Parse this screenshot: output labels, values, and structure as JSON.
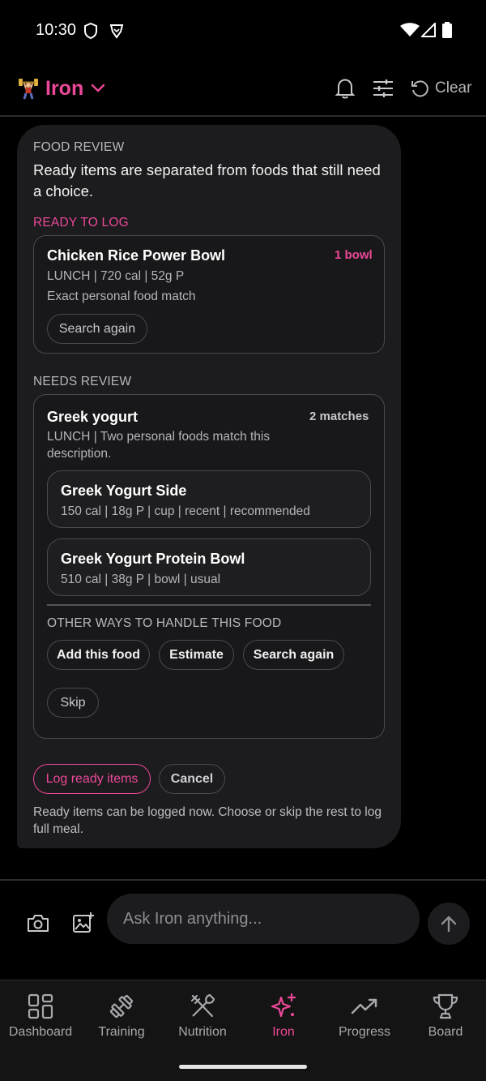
{
  "status": {
    "time": "10:30"
  },
  "header": {
    "app_name": "Iron",
    "clear_label": "Clear"
  },
  "card": {
    "section_label": "FOOD REVIEW",
    "lead": "Ready items are separated from foods that still need a choice.",
    "ready": {
      "label": "READY TO LOG",
      "item": {
        "title": "Chicken Rice Power Bowl",
        "badge": "1 bowl",
        "meta": "LUNCH | 720 cal | 52g P",
        "note": "Exact personal food match",
        "search_again": "Search again"
      }
    },
    "needs_review": {
      "label": "NEEDS REVIEW",
      "item": {
        "title": "Greek yogurt",
        "badge": "2 matches",
        "meta": "LUNCH | Two personal foods match this description.",
        "options": [
          {
            "title": "Greek Yogurt Side",
            "meta": "150 cal | 18g P | cup | recent | recommended"
          },
          {
            "title": "Greek Yogurt Protein Bowl",
            "meta": "510 cal | 38g P | bowl | usual"
          }
        ],
        "other_label": "OTHER WAYS TO HANDLE THIS FOOD",
        "actions": {
          "add": "Add this food",
          "estimate": "Estimate",
          "search": "Search again",
          "skip": "Skip"
        }
      }
    },
    "footer": {
      "log_ready": "Log ready items",
      "cancel": "Cancel",
      "hint": "Ready items can be logged now. Choose or skip the rest to log full meal."
    }
  },
  "composer": {
    "placeholder": "Ask Iron anything..."
  },
  "nav": {
    "items": [
      {
        "label": "Dashboard",
        "icon": "dashboard-icon"
      },
      {
        "label": "Training",
        "icon": "dumbbell-icon"
      },
      {
        "label": "Nutrition",
        "icon": "utensils-icon"
      },
      {
        "label": "Iron",
        "icon": "sparkles-icon"
      },
      {
        "label": "Progress",
        "icon": "trending-up-icon"
      },
      {
        "label": "Board",
        "icon": "trophy-icon"
      }
    ],
    "active": "Iron"
  },
  "colors": {
    "accent": "#ec4899",
    "background": "#000000",
    "card": "#1c1c1e"
  }
}
